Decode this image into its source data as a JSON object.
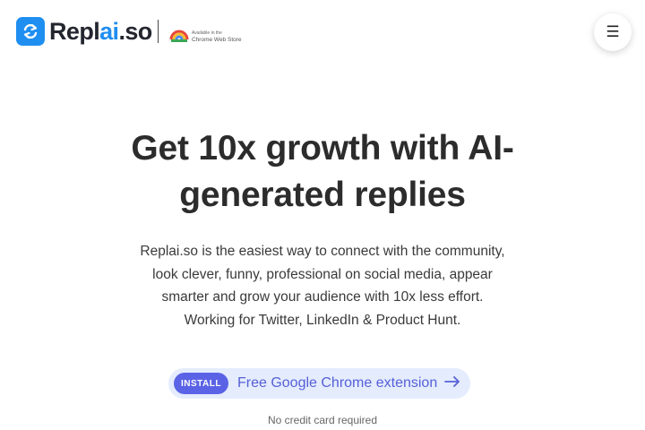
{
  "header": {
    "logo": {
      "text_main": "Repl",
      "text_ai": "ai",
      "text_tld": ".so",
      "icon": "refresh-arrows-icon",
      "brand_color": "#1f8ef1"
    },
    "chrome_badge": {
      "line1": "Available in the",
      "line2": "Chrome Web Store",
      "icon": "chrome-logo-icon"
    },
    "menu": {
      "icon": "hamburger-menu-icon",
      "glyph": "☰"
    }
  },
  "hero": {
    "title": "Get 10x growth with AI-generated replies",
    "description": "Replai.so is the easiest way to connect with the community, look clever, funny, professional on social media, appear smarter and grow your audience with 10x less effort. Working for Twitter, LinkedIn & Product Hunt."
  },
  "cta": {
    "pill_label": "INSTALL",
    "label": "Free Google Chrome extension",
    "icon": "arrow-right-icon",
    "accent": "#5a63e6",
    "background": "#e4ecfd"
  },
  "note": "No credit card required"
}
